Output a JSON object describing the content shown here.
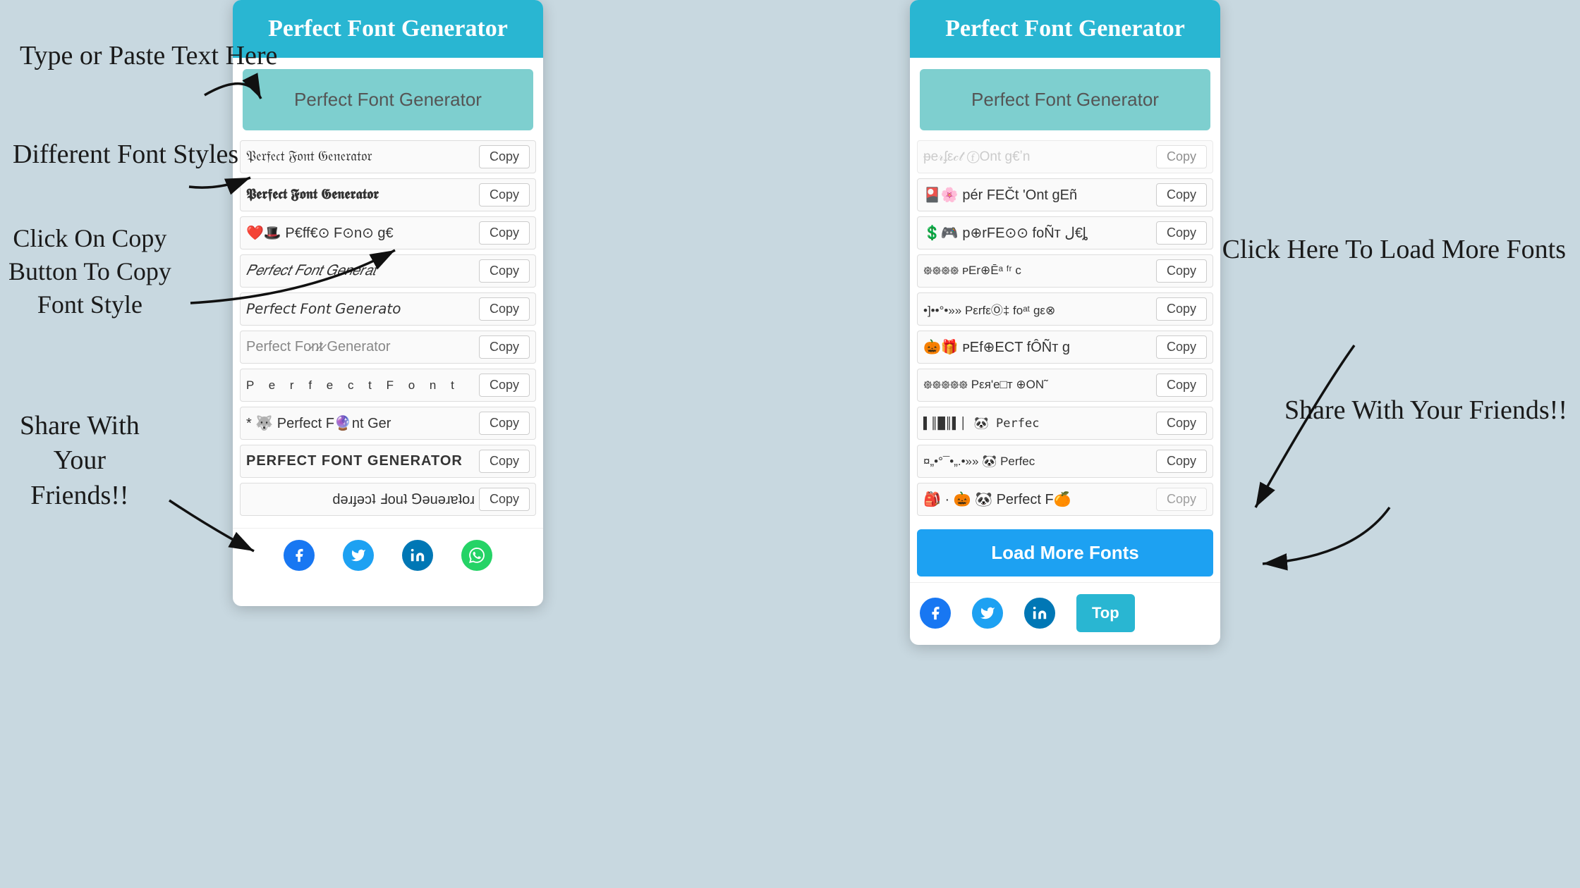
{
  "app": {
    "title": "Perfect Font Generator",
    "input_placeholder": "Perfect Font Generator",
    "header_color": "#29b6d2"
  },
  "annotations": {
    "type_paste": "Type or Paste Text\nHere",
    "diff_fonts": "Different Font\nStyles",
    "click_copy": "Click On Copy\nButton To Copy\nFont Style",
    "share": "Share With\nYour\nFriends!!",
    "load_more": "Click Here To\nLoad More\nFonts",
    "share2": "Share With\nYour\nFriends!!"
  },
  "panel_left": {
    "header": "Perfect Font Generator",
    "input_value": "Perfect Font Generator",
    "fonts": [
      {
        "text": "𝔓𝔢𝔯𝔣𝔢𝔠𝔱 𝔉𝔬𝔫𝔱 𝔊𝔢𝔫𝔢𝔯𝔞𝔱𝔬𝔯",
        "copy": "Copy",
        "style": "fraktur"
      },
      {
        "text": "𝕻𝖊𝖗𝖋𝖊𝖈𝖙 𝕱𝖔𝖓𝖙 𝕲𝖊𝖓𝖊𝖗𝖆𝖙𝖔𝖗",
        "copy": "Copy",
        "style": "bold-fraktur"
      },
      {
        "text": "❤️🎩 P€ff€⊙ F⊙n⊙ g€",
        "copy": "Copy",
        "style": "emoji"
      },
      {
        "text": "𝑃𝑒𝑟𝑓𝑒𝑐𝑡 𝐹𝑜𝑛𝑡 𝐺𝑒𝑛𝑒𝑟𝑎𝑡",
        "copy": "Copy",
        "style": "italic"
      },
      {
        "text": "𝘗𝘦𝘳𝘧𝘦𝘤𝘵 𝘍𝘰𝘯𝘵 𝘎𝘦𝘯𝘦𝘳𝘢𝘵𝘰",
        "copy": "Copy",
        "style": "sans-italic"
      },
      {
        "text": "Perfect Fo̷n̷t̷ Generator",
        "copy": "Copy",
        "style": "strikethrough"
      },
      {
        "text": "P e r f e c t  F o n t",
        "copy": "Copy",
        "style": "spaced"
      },
      {
        "text": "* 🐺 Perfect F🔮nt Ger",
        "copy": "Copy",
        "style": "emoji2"
      },
      {
        "text": "PERFECT FONT GENERATOR",
        "copy": "Copy",
        "style": "caps"
      },
      {
        "text": "ɹoʇɐɹǝuǝ⅁ ʇuoℲ ʇɔǝɟɹǝd",
        "copy": "Copy",
        "style": "upside-down"
      }
    ],
    "share_icons": [
      "facebook",
      "twitter",
      "linkedin",
      "whatsapp"
    ]
  },
  "panel_right": {
    "header": "Perfect Font Generator",
    "input_value": "Perfect Font Generator",
    "fonts_top_partial": "ᵽe𝓇ʄε𝒸𝓉 ⓕOnt g€ʼn",
    "fonts": [
      {
        "text": "pér FEČt 'Ont gEñ",
        "copy": "Copy",
        "style": "mixed1"
      },
      {
        "text": "💲🎮 p⊕rFE⊙⊙ foÑт ﻝ€ȴ",
        "copy": "Copy",
        "style": "emoji3"
      },
      {
        "text": "᪥᪥᪥᪥ ᴘЕr⊕Ē​ᵃ ᶠʳ c",
        "copy": "Copy",
        "style": "mixed2"
      },
      {
        "text": "•]••°•»» PεrfεⓄ‡ fo​ᵃ​ᵗ gε⊗",
        "copy": "Copy",
        "style": "mixed3"
      },
      {
        "text": "🎃🎁 ᴘΕf⊕ΕCT fÔÑт g",
        "copy": "Copy",
        "style": "emoji4"
      },
      {
        "text": "᪥᪥᪥᪥᪥ Pεя'е□т ⊕ON˜",
        "copy": "Copy",
        "style": "mixed4"
      },
      {
        "text": "▌║█║▌│ 🐼 Perfec",
        "copy": "Copy",
        "style": "bar1"
      },
      {
        "text": "¤„•°¯•„.•»» 🐼 Perfec",
        "copy": "Copy",
        "style": "bar2"
      },
      {
        "text": "🎒 · 🎃 🐼 Perfect F🍊",
        "copy": "Copy",
        "style": "emoji5"
      }
    ],
    "load_more_label": "Load More Fonts",
    "top_label": "Top",
    "share_icons": [
      "facebook",
      "twitter",
      "linkedin"
    ]
  },
  "buttons": {
    "copy": "Copy",
    "load_more": "Load More Fonts",
    "top": "Top"
  }
}
